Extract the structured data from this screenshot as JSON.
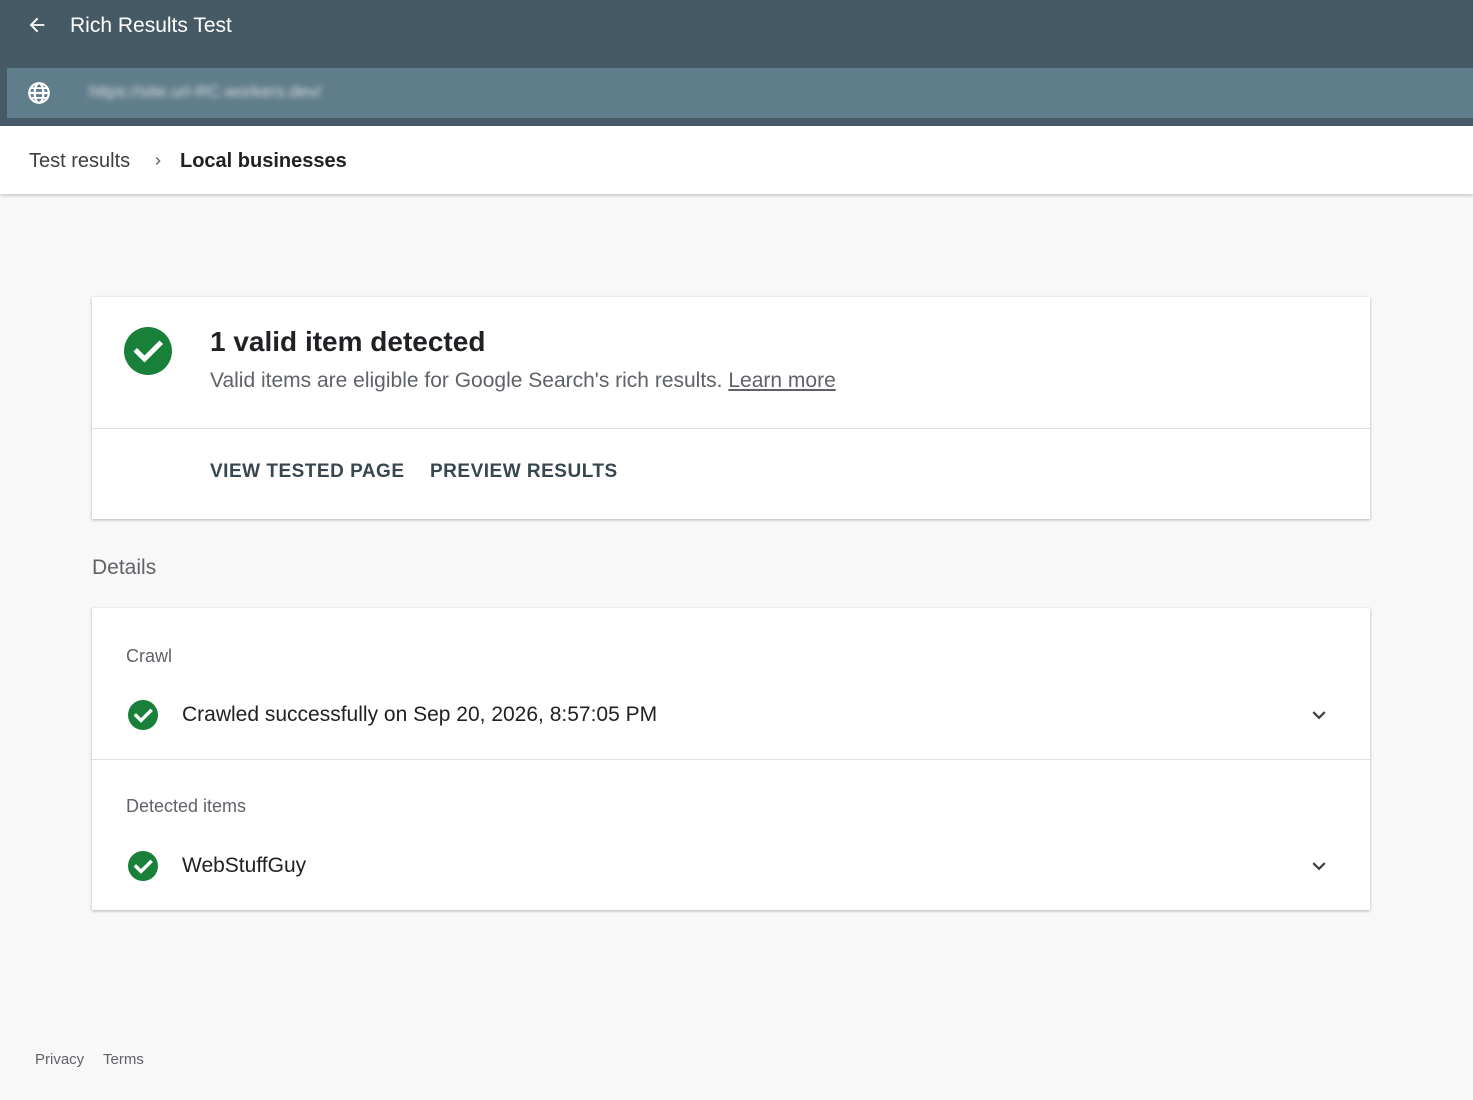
{
  "header": {
    "app_title": "Rich Results Test",
    "back_icon": "arrow-back-icon",
    "url_icon": "globe-icon",
    "tested_url": "https://site.url-RC.workers.dev/"
  },
  "breadcrumb": {
    "root": "Test results",
    "current": "Local businesses"
  },
  "summary": {
    "title": "1 valid item detected",
    "subtitle": "Valid items are eligible for Google Search's rich results.",
    "learn_more": "Learn more",
    "actions": [
      "VIEW TESTED PAGE",
      "PREVIEW RESULTS"
    ]
  },
  "details": {
    "heading": "Details",
    "crawl": {
      "label": "Crawl",
      "text": "Crawled successfully on Sep 20, 2026, 8:57:05 PM"
    },
    "detected": {
      "label": "Detected items",
      "text": "WebStuffGuy"
    }
  },
  "footer": {
    "privacy": "Privacy",
    "terms": "Terms"
  },
  "colors": {
    "header_bg": "#455a64",
    "url_bar_bg": "#607d8b",
    "success_green": "#188038"
  }
}
